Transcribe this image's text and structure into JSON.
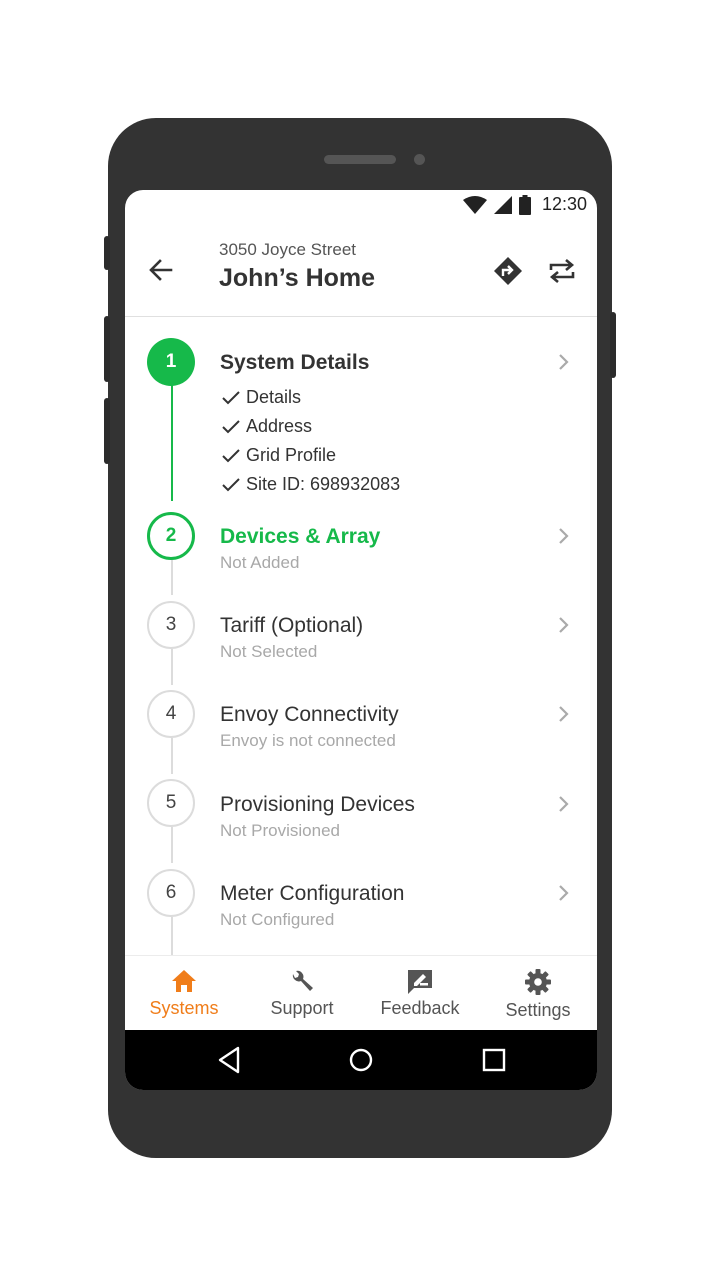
{
  "status_bar": {
    "time": "12:30"
  },
  "header": {
    "street": "3050 Joyce Street",
    "title": "John’s Home",
    "icons": [
      "back-arrow-icon",
      "directions-icon",
      "swap-icon"
    ]
  },
  "steps": [
    {
      "number": "1",
      "title": "System Details",
      "state": "complete",
      "checklist": [
        "Details",
        "Address",
        "Grid Profile",
        "Site ID: 698932083"
      ]
    },
    {
      "number": "2",
      "title": "Devices & Array",
      "subtitle": "Not Added",
      "state": "active"
    },
    {
      "number": "3",
      "title": "Tariff (Optional)",
      "subtitle": "Not Selected",
      "state": "todo"
    },
    {
      "number": "4",
      "title": "Envoy Connectivity",
      "subtitle": "Envoy is not connected",
      "state": "todo"
    },
    {
      "number": "5",
      "title": "Provisioning Devices",
      "subtitle": "Not Provisioned",
      "state": "todo"
    },
    {
      "number": "6",
      "title": "Meter Configuration",
      "subtitle": "Not Configured",
      "state": "todo"
    }
  ],
  "tabs": [
    {
      "label": "Systems",
      "icon": "home-icon",
      "active": true
    },
    {
      "label": "Support",
      "icon": "wrench-icon",
      "active": false
    },
    {
      "label": "Feedback",
      "icon": "feedback-icon",
      "active": false
    },
    {
      "label": "Settings",
      "icon": "gear-icon",
      "active": false
    }
  ],
  "colors": {
    "accent_green": "#16b94a",
    "accent_orange": "#f07d1a",
    "phone_body": "#333333"
  }
}
